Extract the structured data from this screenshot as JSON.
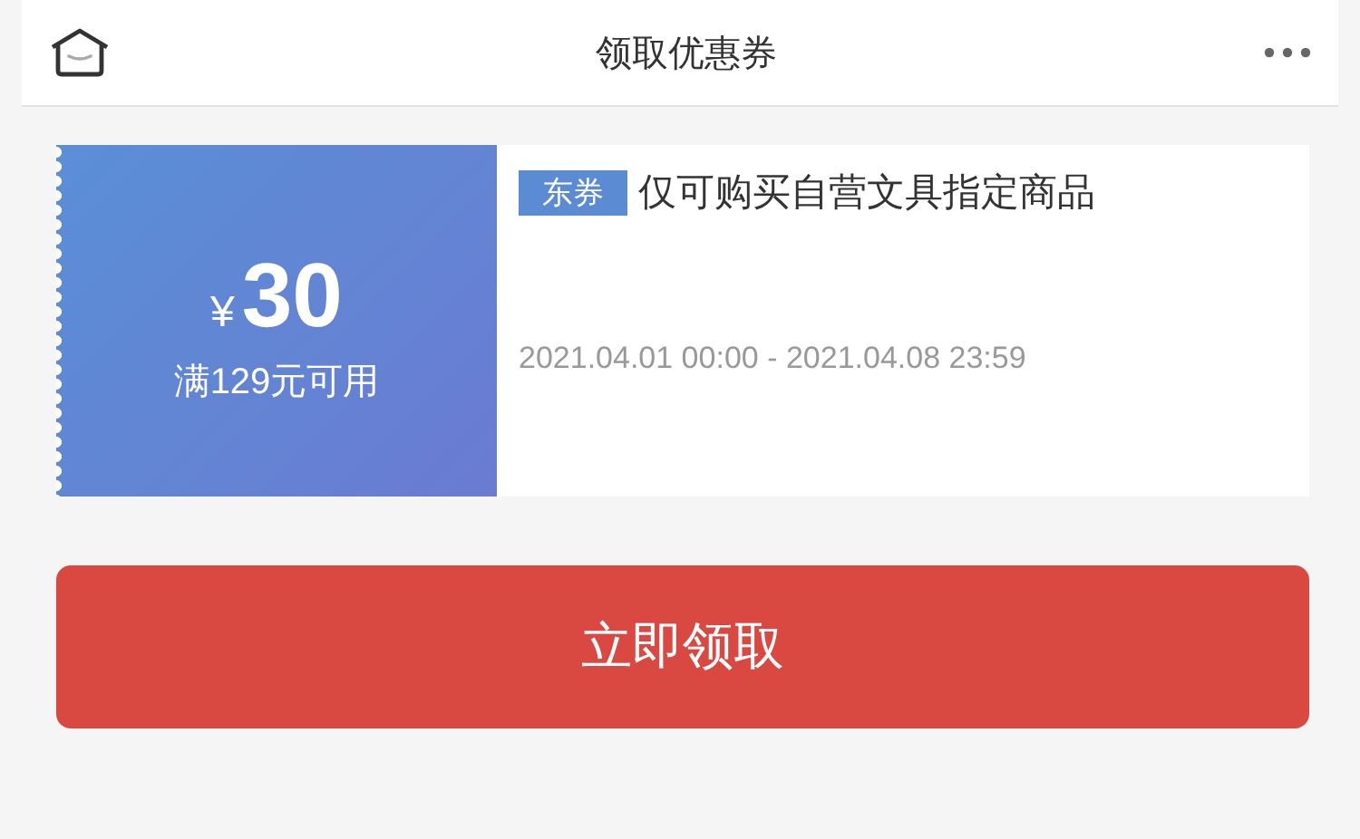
{
  "header": {
    "title": "领取优惠券"
  },
  "coupon": {
    "currency": "¥",
    "amount": "30",
    "condition": "满129元可用",
    "tag": "东券",
    "description": "仅可购买自营文具指定商品",
    "validity": "2021.04.01 00:00 - 2021.04.08 23:59"
  },
  "action_button": {
    "label": "立即领取"
  }
}
